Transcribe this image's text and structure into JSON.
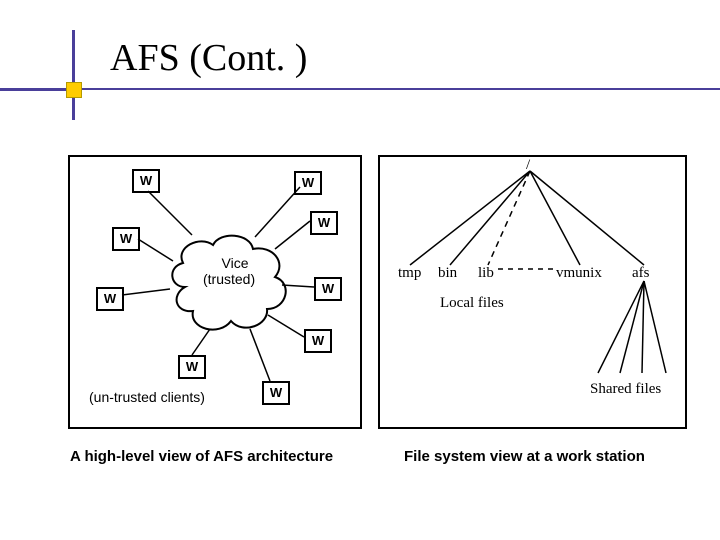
{
  "title": "AFS (Cont. )",
  "left_diagram": {
    "center_label": "Vice",
    "center_sub_label": "(trusted)",
    "client_label": "W",
    "footer_label": "(un-trusted clients)"
  },
  "right_diagram": {
    "root_label": "/",
    "top_dirs": [
      "tmp",
      "bin",
      "lib",
      "vmunix",
      "afs"
    ],
    "mid_label": "Local files",
    "shared_label": "Shared files"
  },
  "captions": {
    "left": "A high-level view of AFS architecture",
    "right": "File system view at a work station"
  },
  "chart_data": [
    {
      "type": "diagram",
      "title": "A high-level view of AFS architecture",
      "description": "Central cloud labeled Vice (trusted) connected to eight client boxes labeled W (un-trusted clients).",
      "center_node": "Vice (trusted)",
      "peripheral_nodes": [
        "W",
        "W",
        "W",
        "W",
        "W",
        "W",
        "W",
        "W"
      ],
      "peripheral_label": "un-trusted clients"
    },
    {
      "type": "diagram",
      "title": "File system view at a work station",
      "description": "Root '/' branches to tmp, bin, lib (dashed), vmunix, afs. tmp/bin/lib/vmunix grouped as Local files. afs branches further to Shared files.",
      "root": "/",
      "children": [
        {
          "name": "tmp",
          "group": "Local files",
          "style": "solid"
        },
        {
          "name": "bin",
          "group": "Local files",
          "style": "solid"
        },
        {
          "name": "lib",
          "group": "Local files",
          "style": "dashed"
        },
        {
          "name": "vmunix",
          "group": "Local files",
          "style": "solid"
        },
        {
          "name": "afs",
          "group": "Shared files",
          "style": "solid",
          "has_subtree": true
        }
      ]
    }
  ]
}
